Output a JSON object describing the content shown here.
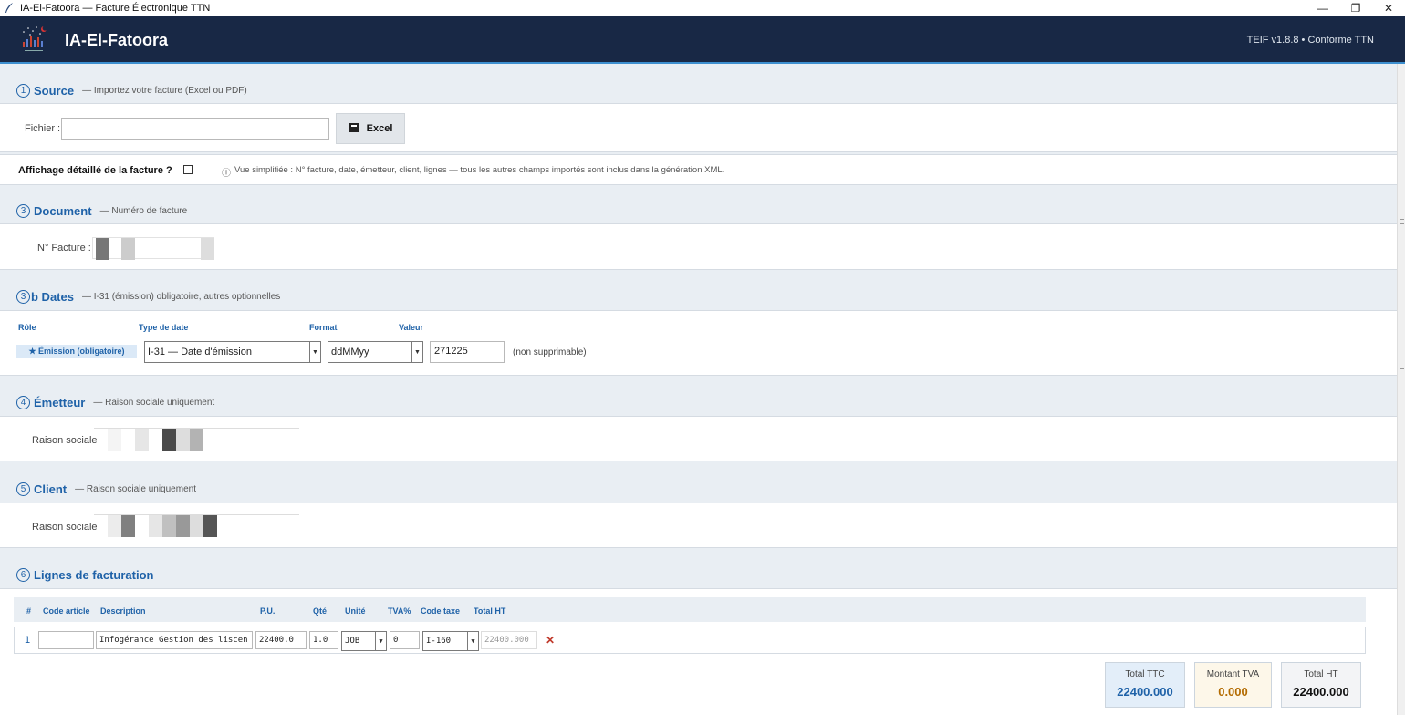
{
  "window": {
    "title": "IA-El-Fatoora — Facture Électronique TTN",
    "minimize": "—",
    "maximize": "❐",
    "close": "✕"
  },
  "header": {
    "brand": "IA-El-Fatoora",
    "version": "TEIF v1.8.8  •  Conforme TTN"
  },
  "source": {
    "num": "1",
    "title": "Source",
    "subtitle": "— Importez votre facture (Excel ou PDF)",
    "file_label": "Fichier :",
    "file_value": "",
    "excel_button": "Excel"
  },
  "detail": {
    "label": "Affichage détaillé de la facture ?",
    "checked": false,
    "info_icon": "ⓘ",
    "info": "Vue simplifiée : N° facture, date, émetteur, client, lignes  —  tous les autres champs importés sont inclus dans la génération XML."
  },
  "document": {
    "num": "3",
    "title": "Document",
    "subtitle": "— Numéro de facture",
    "invoice_label": "N° Facture :"
  },
  "dates": {
    "num": "3",
    "title_suffix": "b Dates",
    "subtitle": "— I-31 (émission) obligatoire, autres optionnelles",
    "headers": {
      "role": "Rôle",
      "type": "Type de date",
      "format": "Format",
      "value": "Valeur"
    },
    "row": {
      "role": "★ Émission (obligatoire)",
      "type": "I-31 — Date d'émission",
      "format": "ddMMyy",
      "value": "271225",
      "note": "(non supprimable)"
    }
  },
  "emetteur": {
    "num": "4",
    "title": "Émetteur",
    "subtitle": "— Raison sociale uniquement",
    "label": "Raison sociale"
  },
  "client": {
    "num": "5",
    "title": "Client",
    "subtitle": "— Raison sociale uniquement",
    "label": "Raison sociale"
  },
  "lines": {
    "num": "6",
    "title": "Lignes de facturation",
    "headers": {
      "idx": "#",
      "code": "Code article",
      "desc": "Description",
      "pu": "P.U.",
      "qte": "Qté",
      "unite": "Unité",
      "tva": "TVA%",
      "code_taxe": "Code taxe",
      "total": "Total HT"
    },
    "rows": [
      {
        "idx": "1",
        "code": "",
        "desc": "Infogérance Gestion des liscen",
        "pu": "22400.0",
        "qte": "1.0",
        "unite": "JOB",
        "tva": "0",
        "code_taxe": "I-160",
        "total": "22400.000",
        "delete": "✕"
      }
    ]
  },
  "totals": {
    "ttc_label": "Total TTC",
    "ttc_value": "22400.000",
    "tva_label": "Montant TVA",
    "tva_value": "0.000",
    "ht_label": "Total HT",
    "ht_value": "22400.000"
  },
  "colors": {
    "header_bg": "#182845",
    "accent": "#1f62a8",
    "delete": "#c0392b",
    "tva": "#b36b00"
  }
}
